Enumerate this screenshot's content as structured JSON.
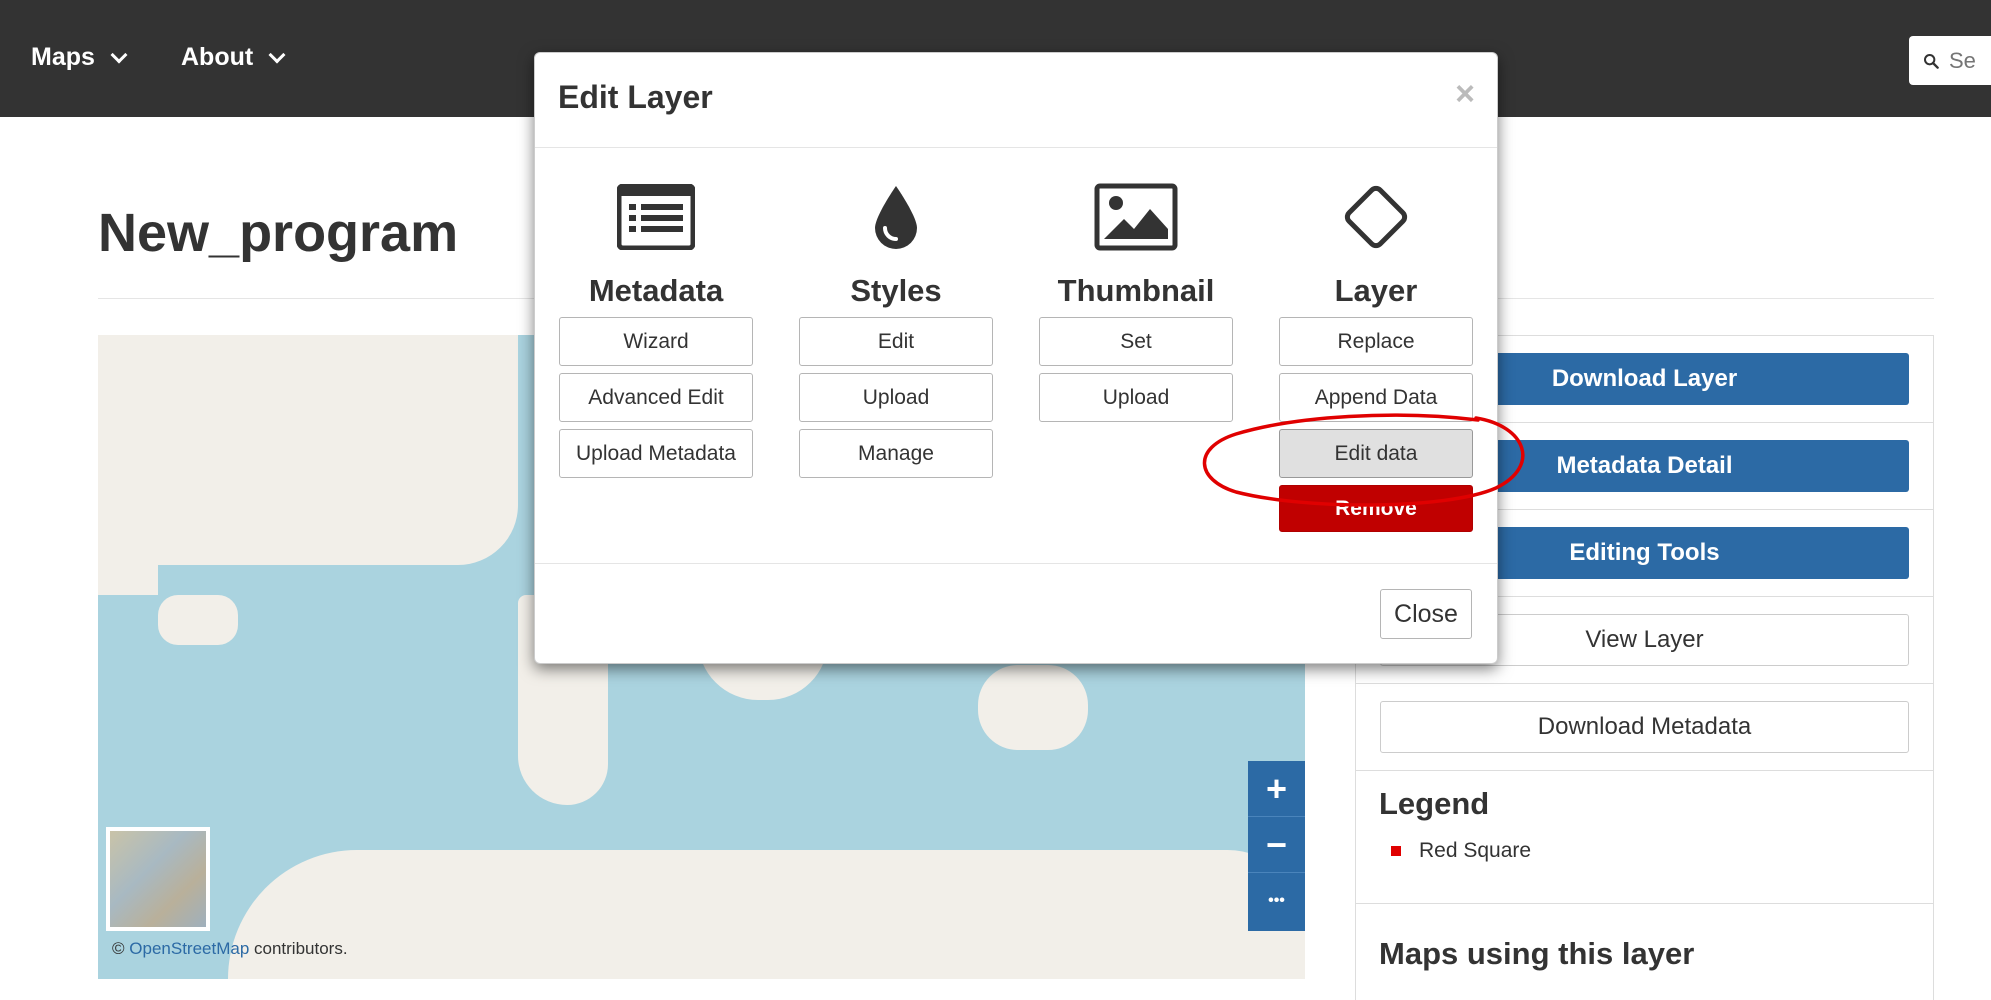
{
  "navbar": {
    "items": [
      {
        "label": "Maps"
      },
      {
        "label": "About"
      }
    ],
    "search_placeholder": "Se"
  },
  "page": {
    "title": "New_program"
  },
  "map": {
    "zoom_in": "+",
    "zoom_out": "−",
    "more": "•••",
    "attribution_prefix": "©",
    "attribution_link": "OpenStreetMap",
    "attribution_suffix": "contributors."
  },
  "right_panel": {
    "buttons": {
      "download_layer": "Download Layer",
      "metadata_detail": "Metadata Detail",
      "editing_tools": "Editing Tools",
      "view_layer": "View Layer",
      "download_metadata": "Download Metadata"
    },
    "legend_title": "Legend",
    "legend_items": [
      {
        "label": "Red Square",
        "color": "#e00000"
      }
    ],
    "maps_title": "Maps using this layer"
  },
  "modal": {
    "title": "Edit Layer",
    "close_x": "×",
    "columns": [
      {
        "icon": "list-icon",
        "heading": "Metadata",
        "buttons": [
          "Wizard",
          "Advanced Edit",
          "Upload Metadata"
        ]
      },
      {
        "icon": "droplet-icon",
        "heading": "Styles",
        "buttons": [
          "Edit",
          "Upload",
          "Manage"
        ]
      },
      {
        "icon": "image-icon",
        "heading": "Thumbnail",
        "buttons": [
          "Set",
          "Upload"
        ]
      },
      {
        "icon": "diamond-icon",
        "heading": "Layer",
        "buttons": [
          "Replace",
          "Append Data",
          "Edit data",
          "Remove"
        ]
      }
    ],
    "close_button": "Close"
  },
  "colors": {
    "navbar_bg": "#333333",
    "primary": "#2c6aa5",
    "danger": "#c00000",
    "annotation": "#e00000",
    "ocean": "#aad3df",
    "land": "#f2efe9"
  }
}
